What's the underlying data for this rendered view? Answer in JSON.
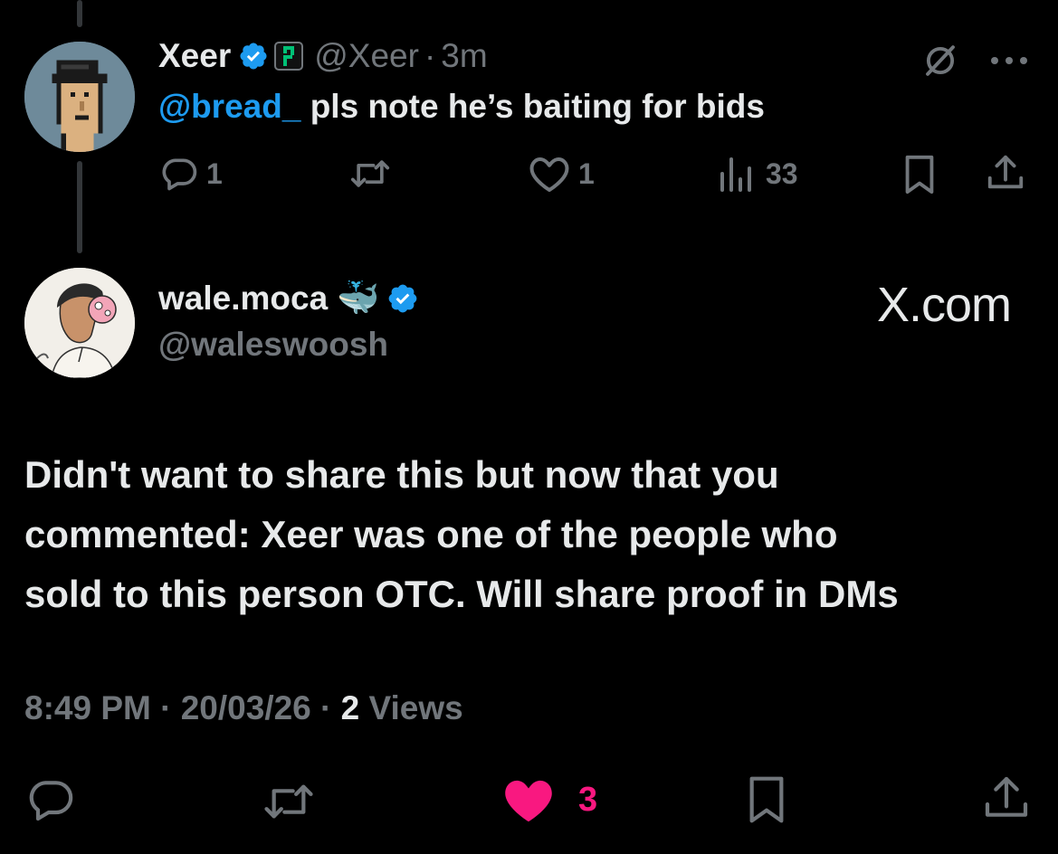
{
  "reply": {
    "display_name": "Xeer",
    "handle": "@Xeer",
    "separator": "·",
    "time": "3m",
    "mention": "@bread_",
    "text": "pls note he’s baiting for bids",
    "replies": "1",
    "likes": "1",
    "views": "33"
  },
  "main": {
    "display_name": "wale.moca",
    "emoji": "🐳",
    "handle": "@waleswoosh",
    "watermark": "X.com",
    "text_lines": [
      "Didn't want to share this but now that you",
      "commented: Xeer was one of the people who",
      "sold to this person OTC. Will share proof in DMs"
    ],
    "time": "8:49 PM",
    "sep1": "·",
    "date": "20/03/26",
    "sep2": "·",
    "views_count": "2",
    "views_label": "Views",
    "likes": "3"
  },
  "colors": {
    "background": "#000000",
    "text": "#e7e9ea",
    "muted": "#71767b",
    "link": "#1d9bf0",
    "liked": "#f91880",
    "badge_green": "#00c076"
  },
  "icons": {
    "verified": "verified-badge-icon",
    "affiliate": "green-p-badge-icon",
    "grok": "slash-circle-icon",
    "more": "more-dots-icon",
    "reply": "reply-bubble-icon",
    "retweet": "retweet-icon",
    "like": "heart-icon",
    "views": "views-chart-icon",
    "bookmark": "bookmark-icon",
    "share": "share-icon"
  }
}
